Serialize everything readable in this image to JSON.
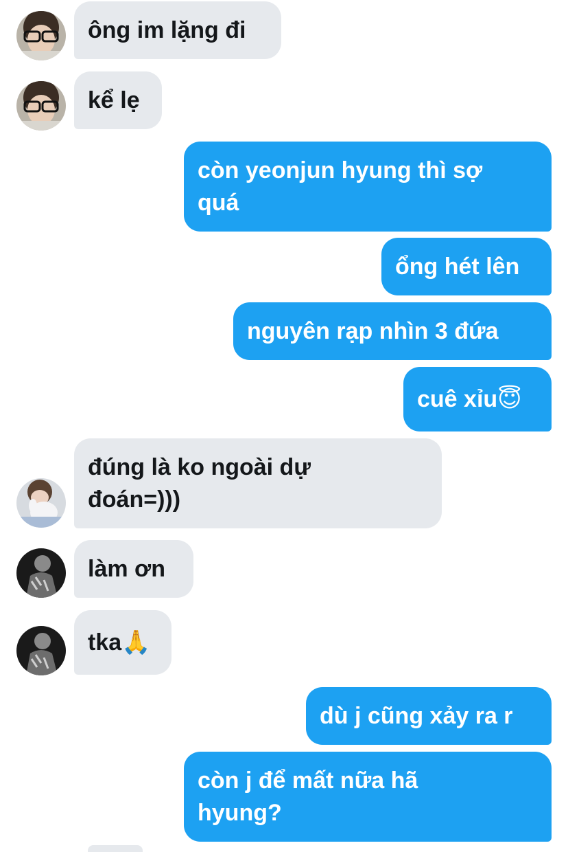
{
  "conversation": {
    "messages": [
      {
        "id": "m1",
        "side": "in",
        "text": "ông im lặng đi",
        "avatar": "avatar-glasses"
      },
      {
        "id": "m2",
        "side": "in",
        "text": "kể lẹ",
        "avatar": "avatar-glasses"
      },
      {
        "id": "m3",
        "side": "out",
        "text": "còn yeonjun hyung thì sợ\nquá"
      },
      {
        "id": "m4",
        "side": "out",
        "text": "ổng hét lên"
      },
      {
        "id": "m5",
        "side": "out",
        "text": "nguyên rạp nhìn 3 đứa"
      },
      {
        "id": "m6",
        "side": "out",
        "text": "cuê xỉu",
        "emoji": "😇"
      },
      {
        "id": "m7",
        "side": "in",
        "text": "đúng là ko ngoài dự\nđoán=)))",
        "avatar": "avatar-plush"
      },
      {
        "id": "m8",
        "side": "in",
        "text": "làm ơn",
        "avatar": "avatar-bw"
      },
      {
        "id": "m9",
        "side": "in",
        "text": "tka",
        "emoji": "🙏",
        "avatar": "avatar-bw"
      },
      {
        "id": "m10",
        "side": "out",
        "text": "dù j cũng xảy ra r"
      },
      {
        "id": "m11",
        "side": "out",
        "text": "còn j để mất nữa hã\nhyung?"
      }
    ]
  },
  "colors": {
    "incoming_bubble": "#e6e9ed",
    "incoming_text": "#14171a",
    "outgoing_bubble": "#1da1f2",
    "outgoing_text": "#ffffff",
    "background": "#ffffff"
  }
}
